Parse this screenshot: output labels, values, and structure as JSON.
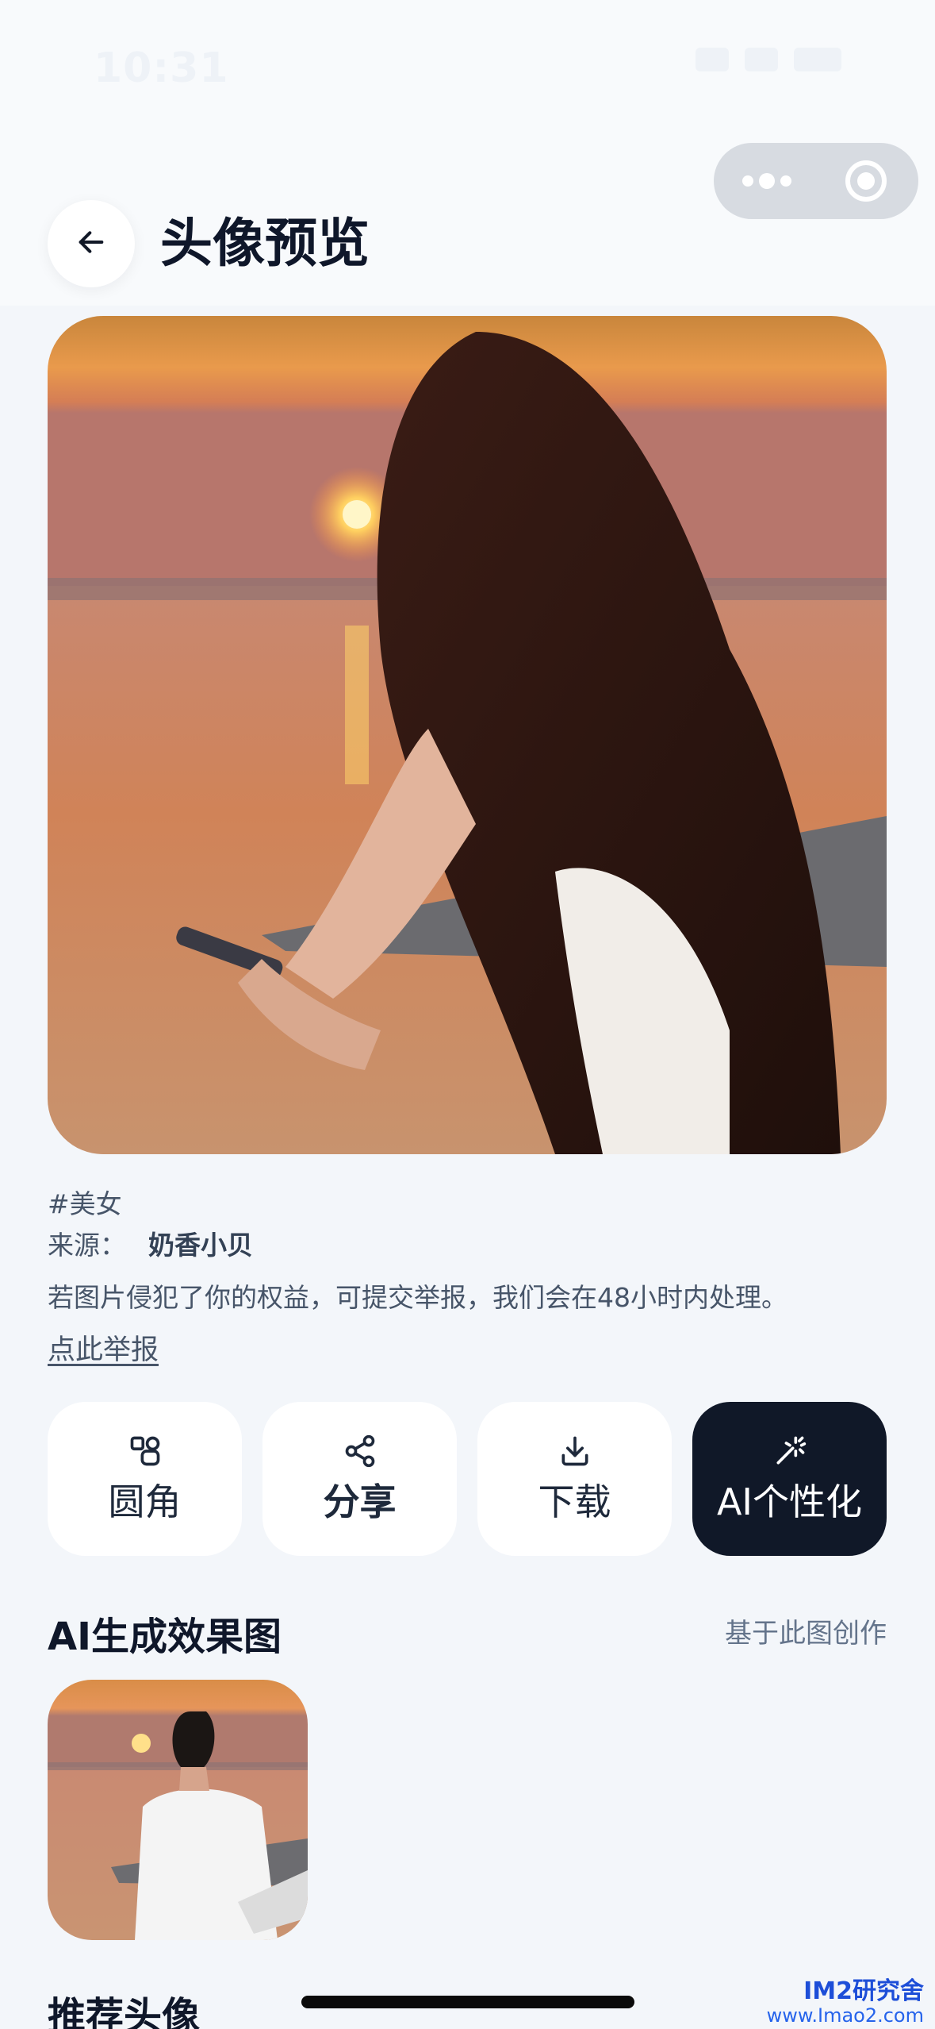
{
  "status_bar": {
    "time": "10:31"
  },
  "header": {
    "title": "头像预览"
  },
  "avatar": {
    "tag": "#美女",
    "source_label": "来源：",
    "source_name": "奶香小贝",
    "notice": "若图片侵犯了你的权益，可提交举报，我们会在48小时内处理。",
    "report_link": "点此举报"
  },
  "actions": [
    {
      "label": "圆角",
      "icon": "rounded-corner-icon"
    },
    {
      "label": "分享",
      "icon": "share-icon"
    },
    {
      "label": "下载",
      "icon": "download-icon"
    },
    {
      "label": "AI个性化",
      "icon": "magic-wand-icon"
    }
  ],
  "ai_section": {
    "title": "AI生成效果图",
    "link": "基于此图创作"
  },
  "recommend_section": {
    "title": "推荐头像"
  },
  "watermark": {
    "name": "IM2研究舍",
    "url": "www.Imao2.com"
  },
  "colors": {
    "background": "#f3f6fa",
    "primary_dark": "#101828",
    "text_secondary": "#475569"
  }
}
